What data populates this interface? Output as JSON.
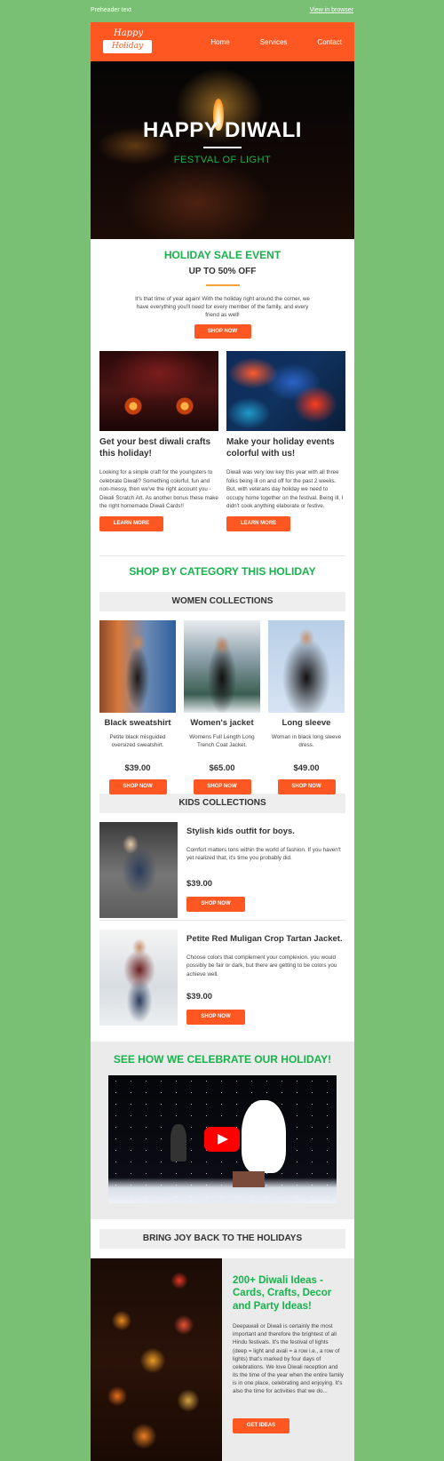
{
  "preheader": {
    "text": "Preheader text",
    "browser_link": "View in browser"
  },
  "header": {
    "logo_line1": "Happy",
    "logo_line2": "Holiday",
    "nav": [
      "Home",
      "Services",
      "Contact"
    ],
    "accent": "#ff5722"
  },
  "hero": {
    "title": "HAPPY DIWALI",
    "subtitle": "FESTVAL OF LIGHT"
  },
  "sale": {
    "title": "HOLIDAY SALE EVENT",
    "subtitle": "UP TO 50% OFF",
    "body": "It's that time of year again! With the holiday right around the corner, we have everything you'll need for every member of the family, and every friend as well!",
    "button": "SHOP NOW"
  },
  "articles": [
    {
      "title": "Get your best diwali crafts this holiday!",
      "body": "Looking for a simple craft for the youngsters to celebrate Diwali? Something colorful, fun and non-messy, then we've the right account you - Diwali Scratch Art. As another bonus these make the right homemade Diwali Cards!!",
      "button": "LEARN MORE"
    },
    {
      "title": "Make your holiday events colorful with us!",
      "body": "Diwali was very low key this year with all three folks being ill on and off for the past 2 weeks. But, with veterans day holiday we need to occupy home together on the festival. Being ill, I didn't cook anything elaborate or festive.",
      "button": "LEARN MORE"
    }
  ],
  "category": {
    "title": "SHOP BY CATEGORY THIS HOLIDAY"
  },
  "women": {
    "title": "WOMEN COLLECTIONS",
    "products": [
      {
        "name": "Black sweatshirt",
        "desc": "Petite black misguided oversized sweatshirt.",
        "price": "$39.00",
        "button": "SHOP NOW"
      },
      {
        "name": "Women's jacket",
        "desc": "Womens Full Length Long Trench Coat Jacket.",
        "price": "$65.00",
        "button": "SHOP NOW"
      },
      {
        "name": "Long sleeve",
        "desc": "Woman in black long sleeve dress.",
        "price": "$49.00",
        "button": "SHOP NOW"
      }
    ]
  },
  "kids": {
    "title": "KIDS COLLECTIONS",
    "products": [
      {
        "name": "Stylish kids outfit for boys.",
        "desc": "Comfort matters tons within the world of fashion. If you haven't yet realized that, it's time you probably did.",
        "price": "$39.00",
        "button": "SHOP NOW"
      },
      {
        "name": "Petite Red Muligan Crop Tartan Jacket.",
        "desc": "Choose colors that complement your complexion. you would possibly be fair or dark, but there are getting to be colors you achieve well.",
        "price": "$39.00",
        "button": "SHOP NOW"
      }
    ]
  },
  "celebrate": {
    "title": "SEE HOW WE CELEBRATE OUR HOLIDAY!"
  },
  "joy": {
    "title": "BRING JOY BACK TO THE HOLIDAYS",
    "heading": "200+ Diwali Ideas - Cards, Crafts, Decor and Party Ideas!",
    "body": "Deepawali or Diwali is certainly the most important and therefore the brightest of all Hindu festivals. It's the festival of lights (deep = light and avali = a row i.e., a row of lights) that's marked by four days of celebrations. We love Diwali reception and its the time of the year when the entire family is in one place, celebrating and enjoying. It's also the time for activities that we do...",
    "button": "GET IDEAS"
  },
  "colors": {
    "background": "#79bf74",
    "green": "#17b34a",
    "orange": "#ff5722"
  }
}
